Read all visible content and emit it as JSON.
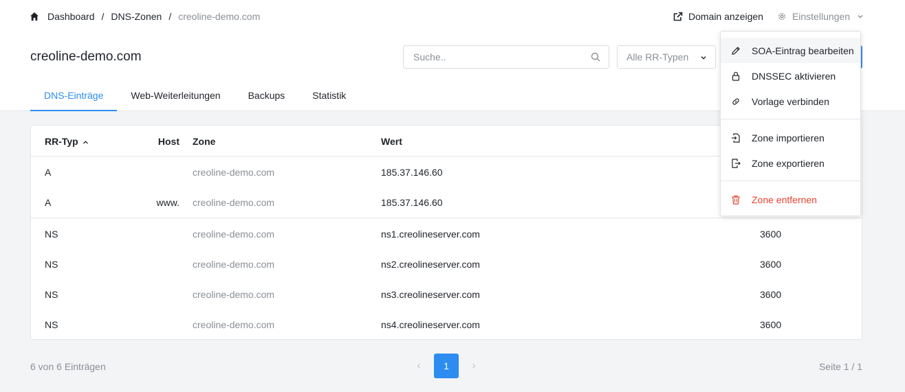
{
  "breadcrumb": {
    "home": "Dashboard",
    "zones": "DNS-Zonen",
    "current": "creoline-demo.com"
  },
  "header": {
    "view_domain": "Domain anzeigen",
    "settings": "Einstellungen"
  },
  "page": {
    "title": "creoline-demo.com"
  },
  "search": {
    "placeholder": "Suche.."
  },
  "filter": {
    "rr_type": "Alle RR-Typen"
  },
  "tabs": [
    "DNS-Einträge",
    "Web-Weiterleitungen",
    "Backups",
    "Statistik"
  ],
  "table": {
    "headers": {
      "type": "RR-Typ",
      "host": "Host",
      "zone": "Zone",
      "value": "Wert"
    },
    "rows": [
      {
        "type": "A",
        "host": "",
        "zone": "creoline-demo.com",
        "value": "185.37.146.60",
        "ttl": ""
      },
      {
        "type": "A",
        "host": "www.",
        "zone": "creoline-demo.com",
        "value": "185.37.146.60",
        "ttl": ""
      },
      {
        "type": "NS",
        "host": "",
        "zone": "creoline-demo.com",
        "value": "ns1.creolineserver.com",
        "ttl": "3600"
      },
      {
        "type": "NS",
        "host": "",
        "zone": "creoline-demo.com",
        "value": "ns2.creolineserver.com",
        "ttl": "3600"
      },
      {
        "type": "NS",
        "host": "",
        "zone": "creoline-demo.com",
        "value": "ns3.creolineserver.com",
        "ttl": "3600"
      },
      {
        "type": "NS",
        "host": "",
        "zone": "creoline-demo.com",
        "value": "ns4.creolineserver.com",
        "ttl": "3600"
      }
    ]
  },
  "footer": {
    "count": "6 von 6 Einträgen",
    "current_page": "1",
    "page_info": "Seite 1 / 1"
  },
  "menu": {
    "items": [
      {
        "label": "SOA-Eintrag bearbeiten",
        "icon": "pencil-icon"
      },
      {
        "label": "DNSSEC aktivieren",
        "icon": "lock-icon"
      },
      {
        "label": "Vorlage verbinden",
        "icon": "link-icon"
      },
      {
        "label": "Zone importieren",
        "icon": "import-icon"
      },
      {
        "label": "Zone exportieren",
        "icon": "export-icon"
      },
      {
        "label": "Zone entfernen",
        "icon": "trash-icon"
      }
    ]
  },
  "colors": {
    "accent": "#2d8cf0",
    "danger": "#e8412f",
    "muted": "#8a8f96",
    "text": "#1f2329"
  }
}
